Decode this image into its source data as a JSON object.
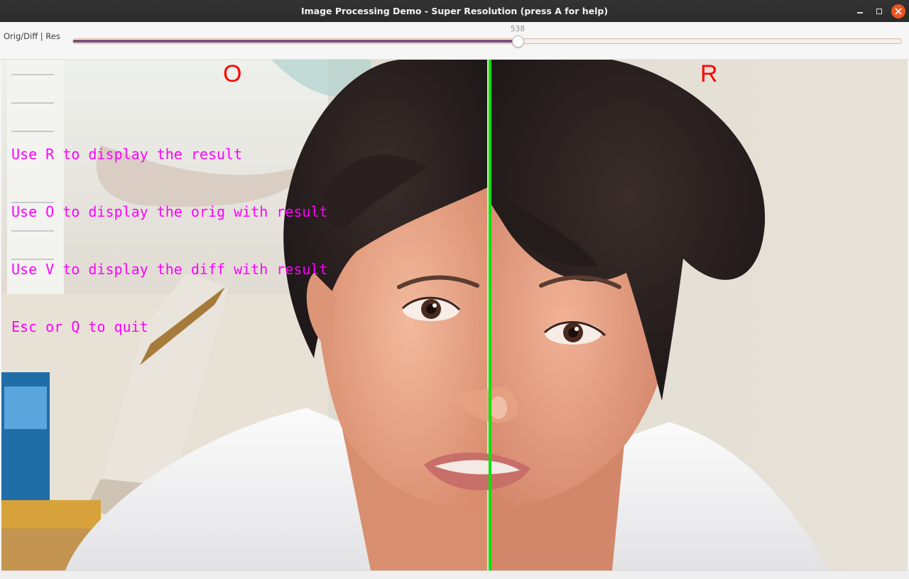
{
  "window": {
    "title": "Image Processing Demo - Super Resolution (press A for help)"
  },
  "trackbar": {
    "label": "Orig/Diff | Res",
    "value": "538",
    "fraction": 0.538
  },
  "overlay": {
    "label_left": "O",
    "label_right": "R",
    "help_lines": [
      "Use R to display the result",
      "Use O to display the orig with result",
      "Use V to display the diff with result",
      "Esc or Q to quit"
    ]
  },
  "colors": {
    "close_button": "#e95420",
    "slider_fill": "#7c4f77",
    "divider": "#00e600",
    "help_text": "#ff00ff",
    "side_labels": "#ff0000"
  },
  "icons": {
    "minimize": "minimize-icon",
    "maximize": "maximize-icon",
    "close": "close-icon"
  }
}
